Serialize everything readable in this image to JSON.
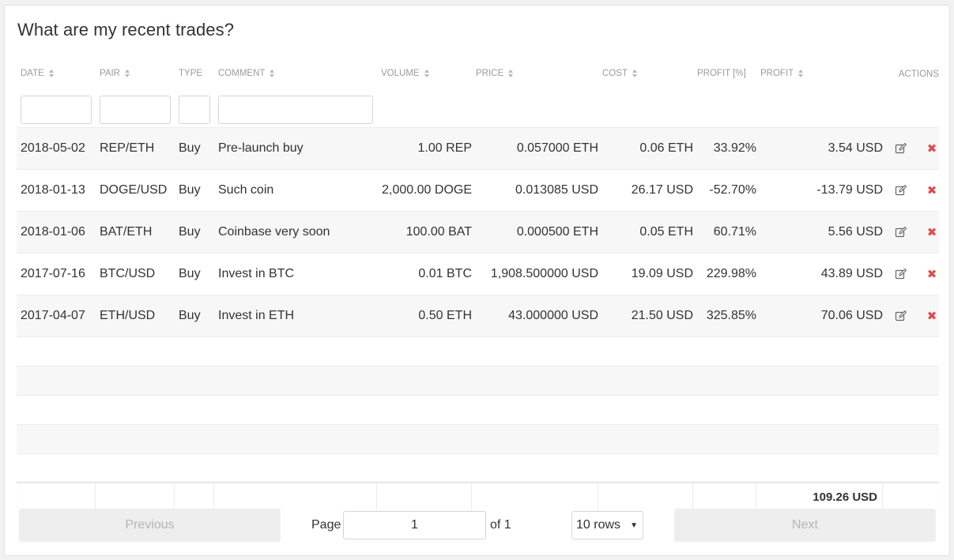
{
  "title": "What are my recent trades?",
  "columns": {
    "date": "DATE",
    "pair": "PAIR",
    "type": "TYPE",
    "comment": "COMMENT",
    "volume": "VOLUME",
    "price": "PRICE",
    "cost": "COST",
    "profit_pct": "PROFIT [%]",
    "profit": "PROFIT",
    "actions": "ACTIONS"
  },
  "trades": [
    {
      "date": "2018-05-02",
      "pair": "REP/ETH",
      "type": "Buy",
      "comment": "Pre-launch buy",
      "volume": "1.00 REP",
      "price": "0.057000 ETH",
      "cost": "0.06 ETH",
      "profit_pct": "33.92%",
      "profit": "3.54 USD"
    },
    {
      "date": "2018-01-13",
      "pair": "DOGE/USD",
      "type": "Buy",
      "comment": "Such coin",
      "volume": "2,000.00 DOGE",
      "price": "0.013085 USD",
      "cost": "26.17 USD",
      "profit_pct": "-52.70%",
      "profit": "-13.79 USD"
    },
    {
      "date": "2018-01-06",
      "pair": "BAT/ETH",
      "type": "Buy",
      "comment": "Coinbase very soon",
      "volume": "100.00 BAT",
      "price": "0.000500 ETH",
      "cost": "0.05 ETH",
      "profit_pct": "60.71%",
      "profit": "5.56 USD"
    },
    {
      "date": "2017-07-16",
      "pair": "BTC/USD",
      "type": "Buy",
      "comment": "Invest in BTC",
      "volume": "0.01 BTC",
      "price": "1,908.500000 USD",
      "cost": "19.09 USD",
      "profit_pct": "229.98%",
      "profit": "43.89 USD"
    },
    {
      "date": "2017-04-07",
      "pair": "ETH/USD",
      "type": "Buy",
      "comment": "Invest in ETH",
      "volume": "0.50 ETH",
      "price": "43.000000 USD",
      "cost": "21.50 USD",
      "profit_pct": "325.85%",
      "profit": "70.06 USD"
    }
  ],
  "icons": {
    "edit": "edit-icon",
    "delete": "delete-icon"
  },
  "delete_color": "#e24a4a",
  "total_profit": "109.26 USD",
  "pagination": {
    "previous_label": "Previous",
    "next_label": "Next",
    "page_label": "Page",
    "page_value": "1",
    "of_label": "of 1",
    "rows_selected": "10 rows"
  }
}
